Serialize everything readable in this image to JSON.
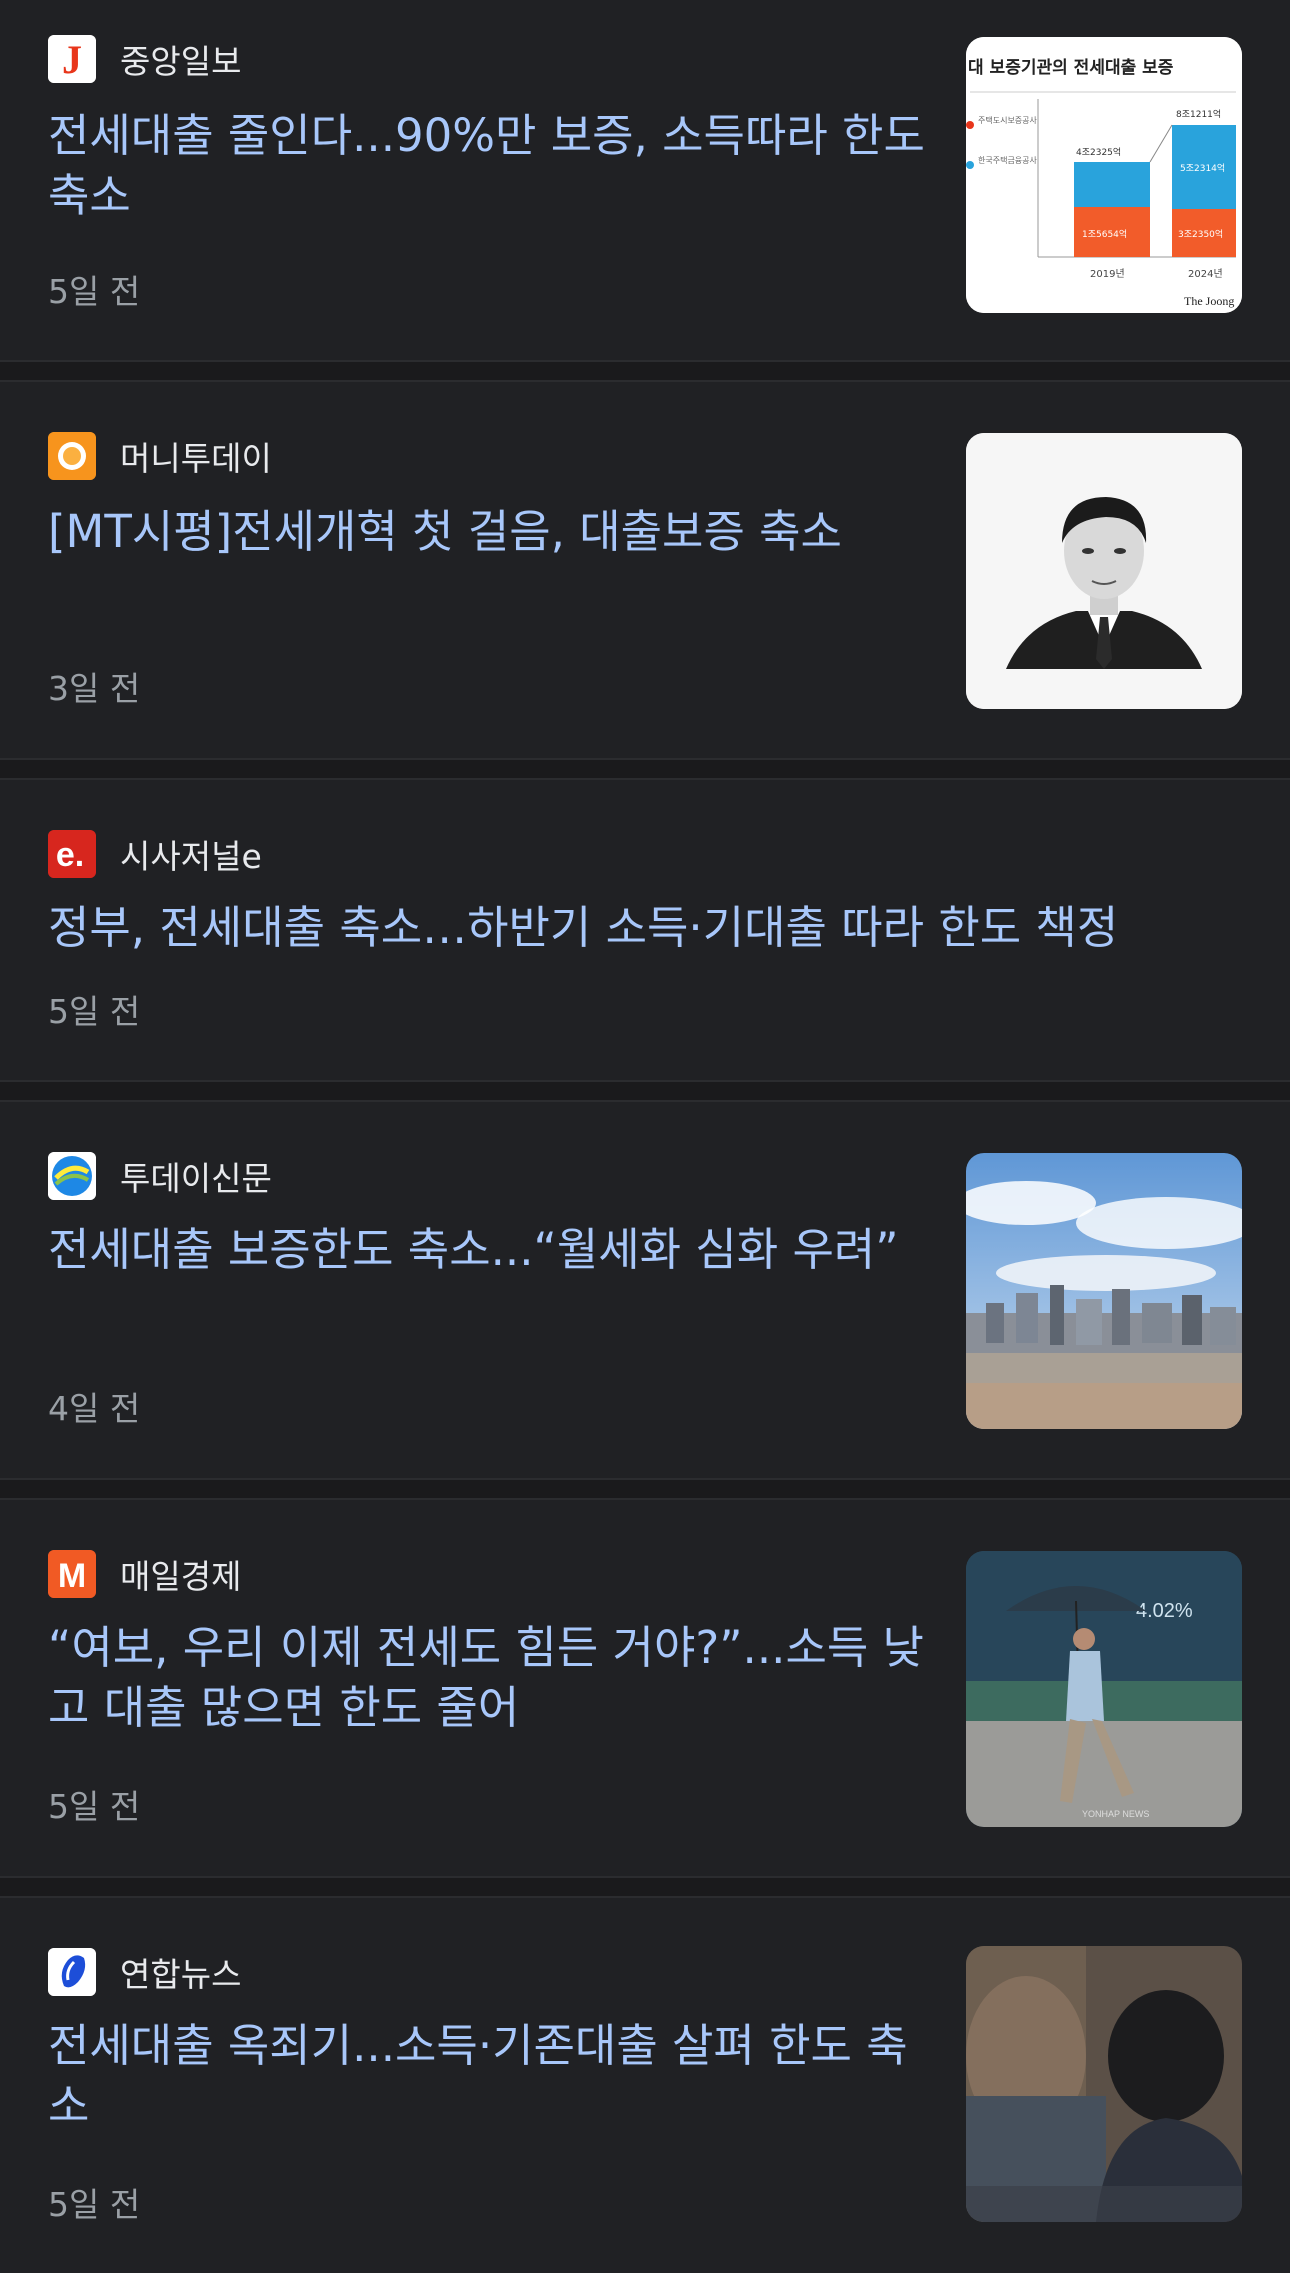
{
  "articles": [
    {
      "source": "중앙일보",
      "title": "전세대출 줄인다...90%만 보증, 소득따라 한도 축소",
      "time": "5일 전",
      "logo_icon": "joongang-logo-icon",
      "logo_color": "#e8361b",
      "logo_glyph": "J",
      "thumbnail": {
        "kind": "chart-image",
        "chart_title": "대 보증기관의 전세대출 보증",
        "legend": [
          "주택도시보증공사",
          "한국주택금융공사"
        ],
        "labels": [
          "8조1211억",
          "5조2314억",
          "4조2325억",
          "1조5654억",
          "3조2350억"
        ],
        "years": [
          "2019년",
          "2024년"
        ],
        "credit": "The Joong"
      }
    },
    {
      "source": "머니투데이",
      "title": "[MT시평]전세개혁 첫 걸음, 대출보증 축소",
      "time": "3일 전",
      "logo_icon": "moneytoday-logo-icon",
      "logo_color": "#f7941d",
      "thumbnail": {
        "kind": "portrait-photo"
      }
    },
    {
      "source": "시사저널e",
      "title": "정부, 전세대출 축소…하반기 소득·기대출 따라 한도 책정",
      "time": "5일 전",
      "logo_icon": "sisajournal-e-logo-icon",
      "logo_color": "#d7261e",
      "logo_glyph": "e."
    },
    {
      "source": "투데이신문",
      "title": "전세대출 보증한도 축소...“월세화 심화 우려”",
      "time": "4일 전",
      "logo_icon": "todaynews-logo-icon",
      "logo_color": "#1e88e5",
      "thumbnail": {
        "kind": "city-skyline-photo"
      }
    },
    {
      "source": "매일경제",
      "title": "“여보, 우리 이제 전세도 힘든 거야?”...소득 낮고 대출 많으면 한도 줄어",
      "time": "5일 전",
      "logo_icon": "maeil-logo-icon",
      "logo_color": "#f15a24",
      "logo_glyph": "M",
      "thumbnail": {
        "kind": "umbrella-pedestrian-photo",
        "overlay_text": "4.02%",
        "watermark": "YONHAP NEWS"
      }
    },
    {
      "source": "연합뉴스",
      "title": "전세대출 옥죄기...소득·기존대출 살펴 한도 축소",
      "time": "5일 전",
      "logo_icon": "yonhap-logo-icon",
      "logo_color": "#1d4ed8",
      "thumbnail": {
        "kind": "meeting-photo"
      }
    }
  ]
}
